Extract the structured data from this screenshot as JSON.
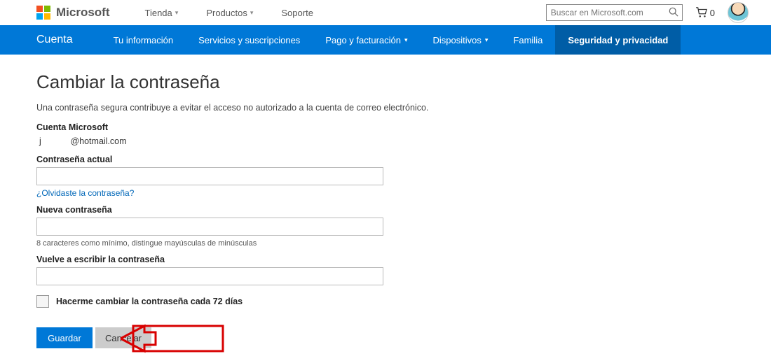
{
  "header": {
    "brand": "Microsoft",
    "nav": [
      {
        "label": "Tienda",
        "dropdown": true
      },
      {
        "label": "Productos",
        "dropdown": true
      },
      {
        "label": "Soporte",
        "dropdown": false
      }
    ],
    "search_placeholder": "Buscar en Microsoft.com",
    "cart_count": "0"
  },
  "blueBar": {
    "account": "Cuenta",
    "items": [
      {
        "label": "Tu información",
        "dropdown": false,
        "active": false
      },
      {
        "label": "Servicios y suscripciones",
        "dropdown": false,
        "active": false
      },
      {
        "label": "Pago y facturación",
        "dropdown": true,
        "active": false
      },
      {
        "label": "Dispositivos",
        "dropdown": true,
        "active": false
      },
      {
        "label": "Familia",
        "dropdown": false,
        "active": false
      },
      {
        "label": "Seguridad y privacidad",
        "dropdown": false,
        "active": true
      }
    ]
  },
  "page": {
    "title": "Cambiar la contraseña",
    "description": "Una contraseña segura contribuye a evitar el acceso no autorizado a la cuenta de correo electrónico.",
    "account_label": "Cuenta Microsoft",
    "account_email_prefix": "j",
    "account_email_suffix": "@hotmail.com",
    "current_password_label": "Contraseña actual",
    "forgot_link": "¿Olvidaste la contraseña?",
    "new_password_label": "Nueva contraseña",
    "new_password_hint": "8 caracteres como mínimo, distingue mayúsculas de minúsculas",
    "confirm_password_label": "Vuelve a escribir la contraseña",
    "checkbox_label": "Hacerme cambiar la contraseña cada 72 días",
    "save_button": "Guardar",
    "cancel_button": "Cancelar"
  }
}
